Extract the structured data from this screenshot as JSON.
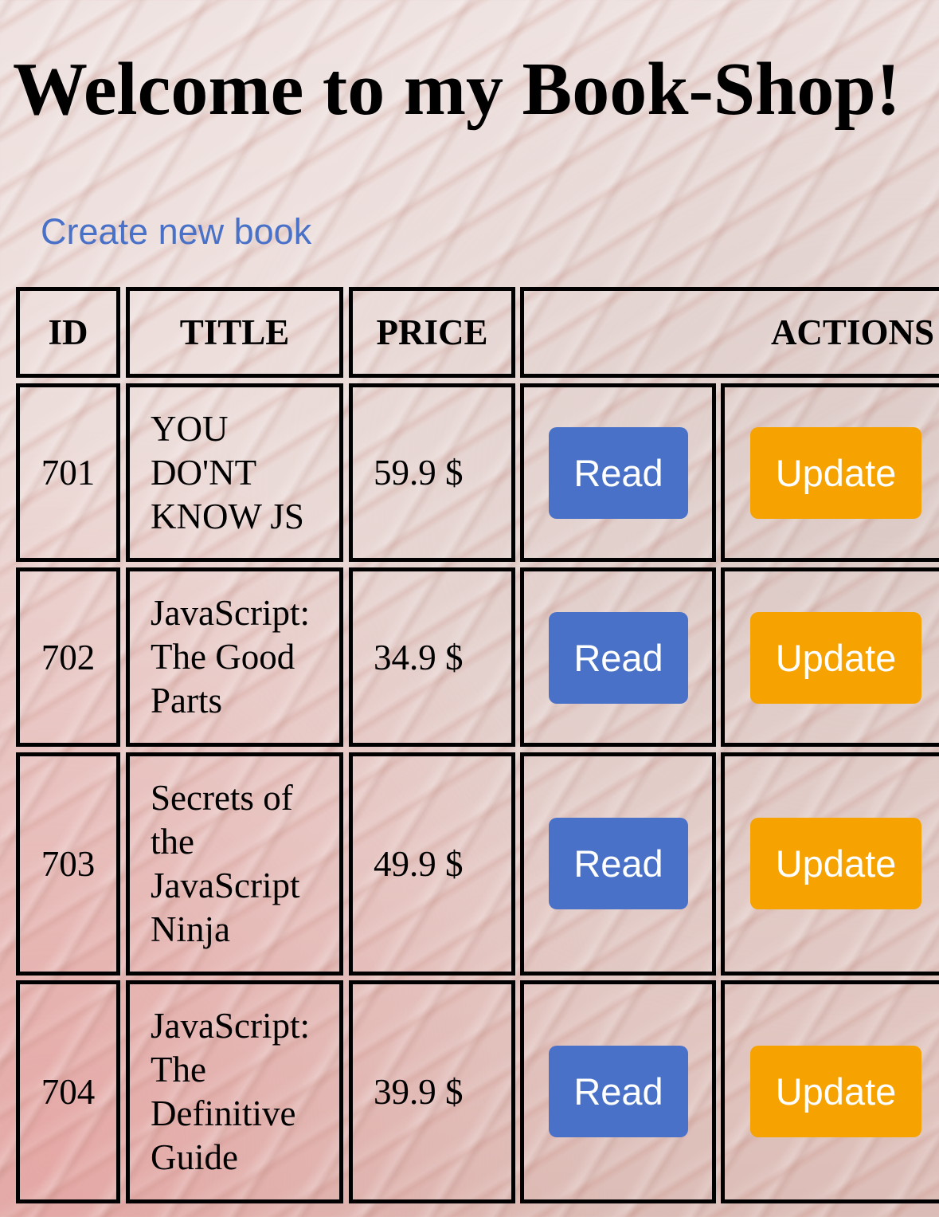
{
  "page": {
    "title": "Welcome to my Book-Shop!",
    "create_link": "Create new book"
  },
  "table": {
    "headers": [
      "ID",
      "TITLE",
      "PRICE",
      "ACTIONS"
    ],
    "rows": [
      {
        "id": "701",
        "title": "YOU DO'NT KNOW JS",
        "price": "59.9 $",
        "read_label": "Read",
        "update_label": "Update"
      },
      {
        "id": "702",
        "title": "JavaScript: The Good Parts",
        "price": "34.9 $",
        "read_label": "Read",
        "update_label": "Update"
      },
      {
        "id": "703",
        "title": "Secrets of the JavaScript Ninja",
        "price": "49.9 $",
        "read_label": "Read",
        "update_label": "Update"
      },
      {
        "id": "704",
        "title": "JavaScript: The Definitive Guide",
        "price": "39.9 $",
        "read_label": "Read",
        "update_label": "Update"
      }
    ]
  },
  "colors": {
    "link": "#4a71c8",
    "read_button": "#4a71c8",
    "update_button": "#f6a200"
  }
}
